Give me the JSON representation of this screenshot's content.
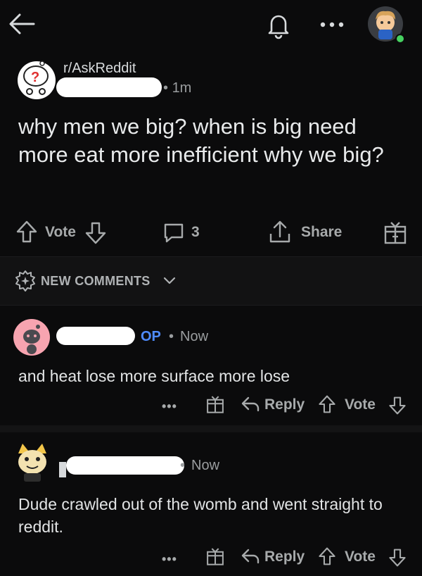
{
  "post": {
    "subreddit": "r/AskReddit",
    "time": "1m",
    "title": "why men we big? when is big need more eat more inefficient why we big?",
    "vote_label": "Vote",
    "comment_count": "3",
    "share_label": "Share"
  },
  "sort": {
    "label": "NEW COMMENTS"
  },
  "comments": [
    {
      "op_badge": "OP",
      "dot": "•",
      "time": "Now",
      "text": "and heat lose more surface more lose",
      "more": "•••",
      "reply_label": "Reply",
      "vote_label": "Vote"
    },
    {
      "dot": "•",
      "time": "Now",
      "text": "Dude crawled out of the womb and went straight to reddit.",
      "more": "•••",
      "reply_label": "Reply",
      "vote_label": "Vote"
    }
  ],
  "colors": {
    "background": "#0b0b0c",
    "op_blue": "#4f8cff",
    "online_green": "#46d160",
    "redaction": "#ffffff"
  }
}
